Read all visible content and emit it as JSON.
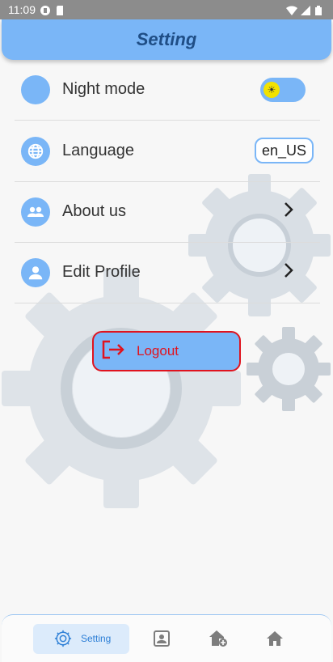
{
  "status_bar": {
    "time": "11:09"
  },
  "app_bar": {
    "title": "Setting"
  },
  "settings": [
    {
      "label": "Night mode",
      "icon": "moon-icon"
    },
    {
      "label": "Language",
      "icon": "globe-icon",
      "value": "en_US"
    },
    {
      "label": "About us",
      "icon": "group-icon"
    },
    {
      "label": "Edit Profile",
      "icon": "person-icon"
    }
  ],
  "night_mode_on": false,
  "logout": {
    "label": "Logout"
  },
  "bottom_nav": {
    "active_label": "Setting",
    "items": [
      "setting-icon",
      "contact-icon",
      "add-home-icon",
      "home-icon"
    ]
  },
  "colors": {
    "accent": "#7ab6f7",
    "title": "#1f4e86",
    "danger": "#e0131e"
  }
}
